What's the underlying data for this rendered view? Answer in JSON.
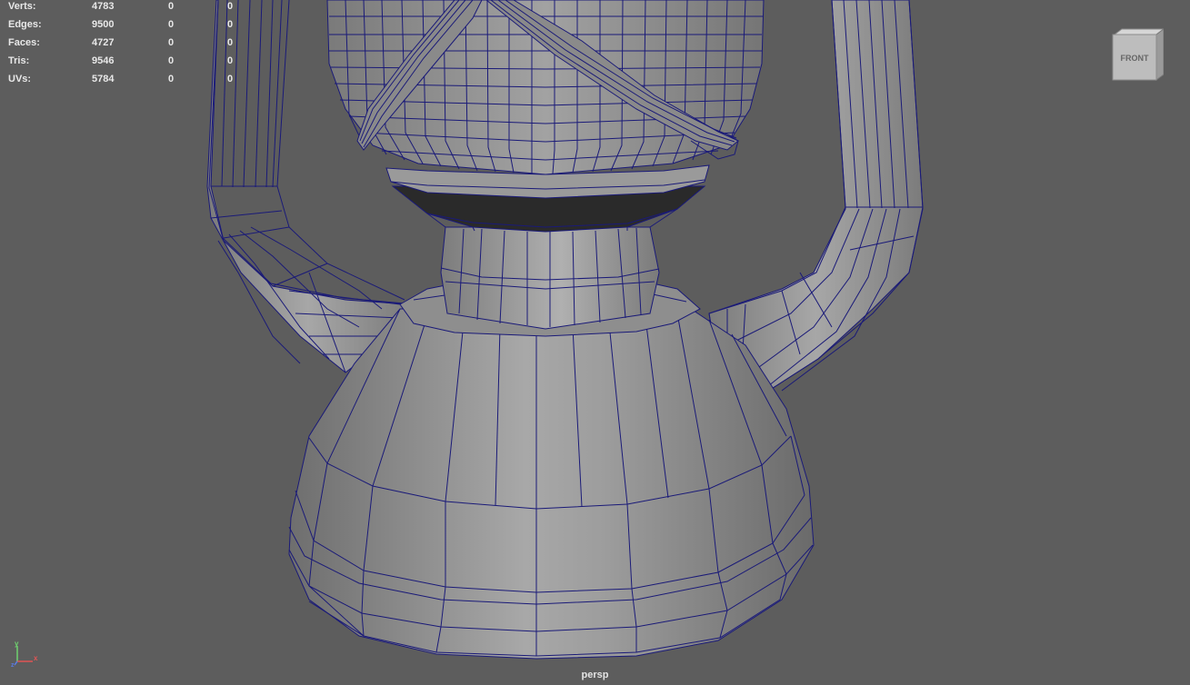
{
  "stats": [
    {
      "label": "Verts:",
      "total": "4783",
      "selected": "0",
      "third": "0"
    },
    {
      "label": "Edges:",
      "total": "9500",
      "selected": "0",
      "third": "0"
    },
    {
      "label": "Faces:",
      "total": "4727",
      "selected": "0",
      "third": "0"
    },
    {
      "label": "Tris:",
      "total": "9546",
      "selected": "0",
      "third": "0"
    },
    {
      "label": "UVs:",
      "total": "5784",
      "selected": "0",
      "third": "0"
    }
  ],
  "viewcube": {
    "face_label": "FRONT"
  },
  "camera": {
    "name": "persp"
  },
  "axis": {
    "x": "x",
    "y": "y",
    "z": "z"
  },
  "colors": {
    "background": "#5d5d5d",
    "wire": "#1a1a7a",
    "shade_light": "#a6a6a6",
    "shade_dark": "#6a6a6a"
  },
  "icons": [
    "viewcube-icon",
    "axis-gizmo-icon"
  ]
}
